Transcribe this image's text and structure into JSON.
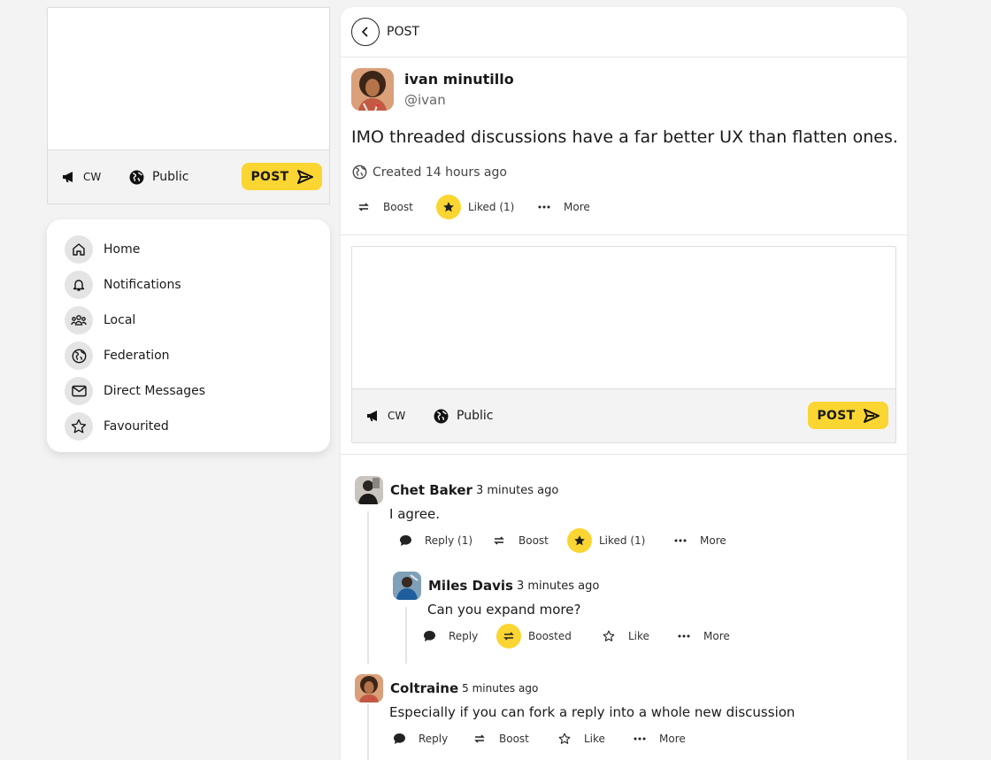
{
  "composer_left": {
    "cw_label": "CW",
    "visibility_label": "Public",
    "post_label": "POST"
  },
  "nav": {
    "items": [
      {
        "label": "Home",
        "icon": "home-icon"
      },
      {
        "label": "Notifications",
        "icon": "bell-icon"
      },
      {
        "label": "Local",
        "icon": "people-icon"
      },
      {
        "label": "Federation",
        "icon": "globe-icon"
      },
      {
        "label": "Direct Messages",
        "icon": "envelope-icon"
      },
      {
        "label": "Favourited",
        "icon": "star-icon"
      }
    ]
  },
  "header": {
    "title": "POST"
  },
  "post": {
    "author_name": "ivan minutillo",
    "author_handle": "@ivan",
    "text": "IMO threaded discussions have a far better UX than flatten ones.",
    "created": "Created 14 hours ago",
    "actions": {
      "boost": "Boost",
      "liked": "Liked (1)",
      "more": "More"
    }
  },
  "composer_main": {
    "cw_label": "CW",
    "visibility_label": "Public",
    "post_label": "POST"
  },
  "replies": [
    {
      "name": "Chet Baker",
      "time": "3 minutes ago",
      "text": "I agree.",
      "actions": {
        "reply": "Reply (1)",
        "boost": "Boost",
        "like": "Liked (1)",
        "more": "More"
      }
    },
    {
      "name": "Miles Davis",
      "time": "3 minutes ago",
      "text": "Can you expand more?",
      "actions": {
        "reply": "Reply",
        "boost": "Boosted",
        "like": "Like",
        "more": "More"
      }
    },
    {
      "name": "Coltraine",
      "time": "5 minutes ago",
      "text": "Especially if you can fork a reply into a whole new discussion",
      "actions": {
        "reply": "Reply",
        "boost": "Boost",
        "like": "Like",
        "more": "More"
      }
    }
  ],
  "colors": {
    "accent": "#fbd531",
    "background": "#f3f3f3"
  }
}
